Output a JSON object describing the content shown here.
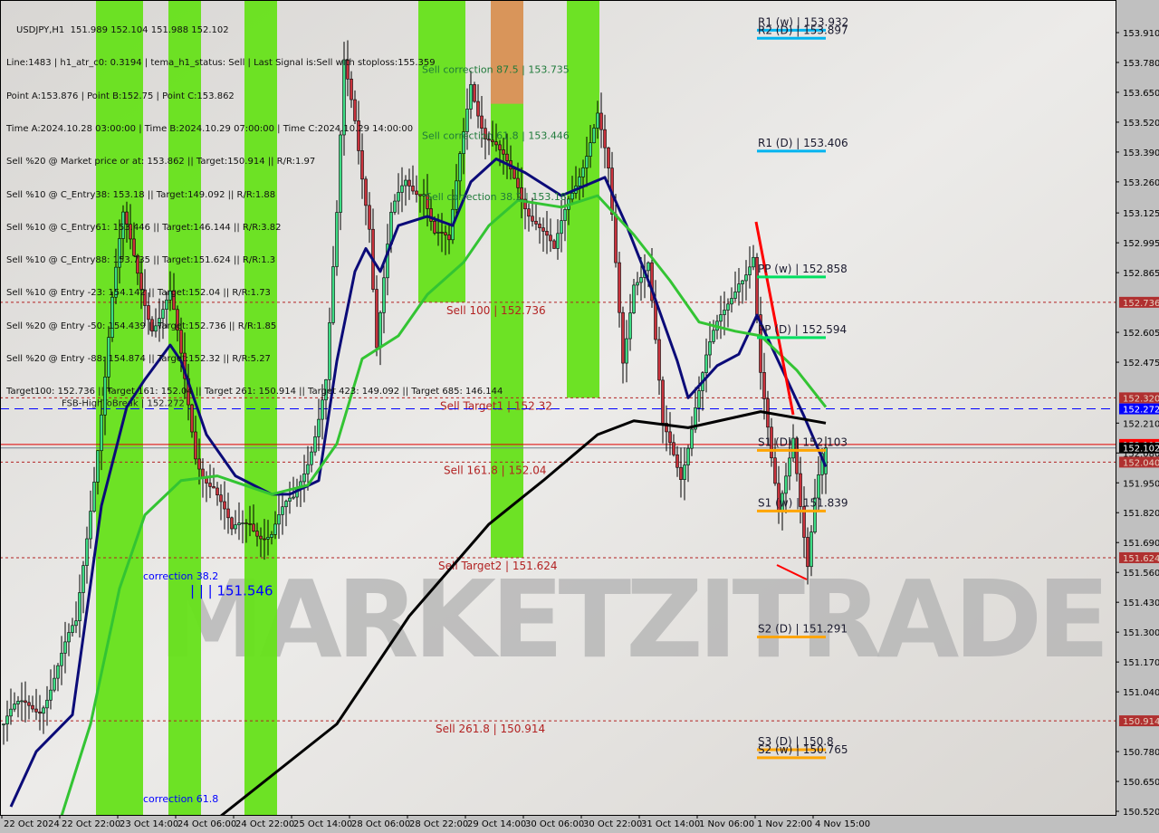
{
  "header": {
    "symbol": "USDJPY,H1",
    "ohlc": "151.989 152.104 151.988 152.102",
    "lines": [
      "Line:1483 | h1_atr_c0: 0.3194 | tema_h1_status: Sell | Last Signal is:Sell with stoploss:155.359",
      "Point A:153.876 | Point B:152.75 | Point C:153.862",
      "Time A:2024.10.28 03:00:00 | Time B:2024.10.29 07:00:00 | Time C:2024.10.29 14:00:00",
      "Sell %20 @ Market price or at: 153.862 || Target:150.914 || R/R:1.97",
      "Sell %10 @ C_Entry38: 153.18 || Target:149.092 || R/R:1.88",
      "Sell %10 @ C_Entry61: 153.446 || Target:146.144 || R/R:3.82",
      "Sell %10 @ C_Entry88: 153.735 || Target:151.624 || R/R:1.3",
      "Sell %10 @ Entry -23: 154.142 || Target:152.04 || R/R:1.73",
      "Sell %20 @ Entry -50: 154.439 || Target:152.736 || R/R:1.85",
      "Sell %20 @ Entry -88: 154.874 || Target:152.32 || R/R:5.27",
      "Target100: 152.736 || Target 161: 152.04 || Target 261: 150.914 || Target 423: 149.092 || Target 685: 146.144"
    ]
  },
  "watermark": "MARKETZITRADE",
  "colors": {
    "background": "#e2e0dd",
    "bull": "#3ddc84",
    "bear": "#c8323c",
    "zone": "#66e21a",
    "zone_orange": "#d9955a",
    "ma_fast": "#0b0b78",
    "ma_mid": "#33c433",
    "ma_slow": "#000000",
    "level_red": "#b22222",
    "level_blue": "#0000ff",
    "pivot_blue": "#00b4f0",
    "pivot_green": "#00e060",
    "pivot_orange": "#ffa500"
  },
  "chart_data": {
    "type": "candlestick",
    "instrument": "USDJPY",
    "timeframe": "H1",
    "ylim": [
      150.52,
      153.91
    ],
    "y_ticks": [
      "153.910",
      "153.780",
      "153.650",
      "153.520",
      "153.390",
      "153.260",
      "153.125",
      "152.995",
      "152.865",
      "152.605",
      "152.475",
      "152.210",
      "152.080",
      "151.950",
      "151.820",
      "151.690",
      "151.560",
      "151.430",
      "151.300",
      "151.170",
      "151.040",
      "150.780",
      "150.650",
      "150.520"
    ],
    "x_ticks": [
      {
        "bar": 0,
        "label": "22 Oct 2024"
      },
      {
        "bar": 16,
        "label": "22 Oct 22:00"
      },
      {
        "bar": 32,
        "label": "23 Oct 14:00"
      },
      {
        "bar": 48,
        "label": "24 Oct 06:00"
      },
      {
        "bar": 64,
        "label": "24 Oct 22:00"
      },
      {
        "bar": 80,
        "label": "25 Oct 14:00"
      },
      {
        "bar": 96,
        "label": "28 Oct 06:00"
      },
      {
        "bar": 112,
        "label": "28 Oct 22:00"
      },
      {
        "bar": 128,
        "label": "29 Oct 14:00"
      },
      {
        "bar": 144,
        "label": "30 Oct 06:00"
      },
      {
        "bar": 160,
        "label": "30 Oct 22:00"
      },
      {
        "bar": 176,
        "label": "31 Oct 14:00"
      },
      {
        "bar": 192,
        "label": "1 Nov 06:00"
      },
      {
        "bar": 208,
        "label": "1 Nov 22:00"
      },
      {
        "bar": 224,
        "label": "4 Nov 15:00"
      }
    ],
    "bars": 228,
    "close_path": [
      [
        0,
        150.9
      ],
      [
        10,
        151.0
      ],
      [
        20,
        151.3
      ],
      [
        26,
        152.15
      ],
      [
        30,
        152.75
      ],
      [
        33,
        153.07
      ],
      [
        37,
        152.86
      ],
      [
        41,
        152.67
      ],
      [
        46,
        152.75
      ],
      [
        50,
        152.36
      ],
      [
        53,
        152.08
      ],
      [
        58,
        151.96
      ],
      [
        63,
        151.69
      ],
      [
        68,
        151.8
      ],
      [
        74,
        151.73
      ],
      [
        80,
        151.85
      ],
      [
        84,
        152.08
      ],
      [
        89,
        152.4
      ],
      [
        92,
        153.07
      ],
      [
        94,
        153.74
      ],
      [
        97,
        153.54
      ],
      [
        101,
        153.11
      ],
      [
        103,
        152.56
      ],
      [
        107,
        153.07
      ],
      [
        111,
        153.26
      ],
      [
        116,
        153.26
      ],
      [
        119,
        153.03
      ],
      [
        123,
        152.95
      ],
      [
        126,
        153.38
      ],
      [
        129,
        153.74
      ],
      [
        133,
        153.46
      ],
      [
        137,
        153.34
      ],
      [
        142,
        153.26
      ],
      [
        147,
        153.11
      ],
      [
        152,
        152.91
      ],
      [
        156,
        153.19
      ],
      [
        159,
        153.34
      ],
      [
        164,
        153.54
      ],
      [
        167,
        153.26
      ],
      [
        171,
        152.48
      ],
      [
        174,
        152.87
      ],
      [
        178,
        152.91
      ],
      [
        182,
        152.15
      ],
      [
        187,
        152.0
      ],
      [
        191,
        152.32
      ],
      [
        194,
        152.48
      ],
      [
        199,
        152.67
      ],
      [
        203,
        152.87
      ],
      [
        207,
        152.95
      ],
      [
        209,
        152.4
      ],
      [
        212,
        152.0
      ],
      [
        214,
        151.8
      ],
      [
        218,
        152.2
      ],
      [
        222,
        151.6
      ],
      [
        224,
        151.85
      ],
      [
        227,
        152.102
      ]
    ],
    "last": {
      "open": 151.989,
      "high": 152.104,
      "low": 151.988,
      "close": 152.102
    },
    "moving_averages": [
      {
        "color_key": "ma_fast",
        "points": [
          [
            2,
            150.54
          ],
          [
            9,
            150.78
          ],
          [
            19,
            150.94
          ],
          [
            27,
            151.85
          ],
          [
            34,
            152.28
          ],
          [
            39,
            152.4
          ],
          [
            46,
            152.55
          ],
          [
            49,
            152.48
          ],
          [
            56,
            152.16
          ],
          [
            64,
            151.98
          ],
          [
            74,
            151.9
          ],
          [
            79,
            151.9
          ],
          [
            87,
            151.96
          ],
          [
            92,
            152.48
          ],
          [
            97,
            152.87
          ],
          [
            100,
            152.97
          ],
          [
            104,
            152.87
          ],
          [
            109,
            153.07
          ],
          [
            117,
            153.11
          ],
          [
            124,
            153.07
          ],
          [
            129,
            153.26
          ],
          [
            136,
            153.36
          ],
          [
            144,
            153.3
          ],
          [
            154,
            153.2
          ],
          [
            166,
            153.28
          ],
          [
            172,
            153.07
          ],
          [
            179,
            152.79
          ],
          [
            186,
            152.48
          ],
          [
            189,
            152.32
          ],
          [
            197,
            152.46
          ],
          [
            203,
            152.51
          ],
          [
            208,
            152.68
          ],
          [
            213,
            152.51
          ],
          [
            221,
            152.24
          ],
          [
            227,
            152.02
          ]
        ]
      },
      {
        "color_key": "ma_mid",
        "points": [
          [
            16,
            150.5
          ],
          [
            24,
            150.9
          ],
          [
            32,
            151.49
          ],
          [
            39,
            151.81
          ],
          [
            49,
            151.96
          ],
          [
            59,
            151.98
          ],
          [
            74,
            151.9
          ],
          [
            84,
            151.94
          ],
          [
            92,
            152.12
          ],
          [
            99,
            152.49
          ],
          [
            109,
            152.59
          ],
          [
            117,
            152.77
          ],
          [
            127,
            152.91
          ],
          [
            134,
            153.07
          ],
          [
            142,
            153.18
          ],
          [
            154,
            153.15
          ],
          [
            164,
            153.2
          ],
          [
            174,
            153.03
          ],
          [
            184,
            152.83
          ],
          [
            192,
            152.65
          ],
          [
            202,
            152.61
          ],
          [
            209,
            152.59
          ],
          [
            219,
            152.44
          ],
          [
            227,
            152.28
          ]
        ]
      },
      {
        "color_key": "ma_slow",
        "points": [
          [
            60,
            150.5
          ],
          [
            92,
            150.9
          ],
          [
            112,
            151.37
          ],
          [
            134,
            151.77
          ],
          [
            149,
            151.96
          ],
          [
            164,
            152.16
          ],
          [
            174,
            152.22
          ],
          [
            189,
            152.19
          ],
          [
            209,
            152.26
          ],
          [
            227,
            152.21
          ]
        ]
      }
    ],
    "zones": [
      {
        "from": 26,
        "to": 38,
        "color_key": "zone"
      },
      {
        "from": 46,
        "to": 54,
        "color_key": "zone"
      },
      {
        "from": 67,
        "to": 75,
        "color_key": "zone"
      },
      {
        "from": 115,
        "to": 127,
        "color_key": "zone",
        "low": 152.736
      },
      {
        "from": 135,
        "to": 143,
        "color_key": "zone",
        "low": 151.624,
        "orange_above": 153.6
      },
      {
        "from": 156,
        "to": 164,
        "color_key": "zone",
        "low": 152.32
      }
    ],
    "levels": [
      {
        "price": 152.736,
        "label": "Sell 100 | 152.736",
        "axis_label": "152.736",
        "style": "red"
      },
      {
        "price": 152.32,
        "label": "Sell Target1 | 152.32",
        "axis_label": "152.320",
        "style": "red"
      },
      {
        "price": 152.04,
        "label": "Sell 161.8 | 152.04",
        "axis_label": "152.040",
        "style": "red"
      },
      {
        "price": 151.624,
        "label": "Sell Target2 | 151.624",
        "axis_label": "151.624",
        "style": "red"
      },
      {
        "price": 150.914,
        "label": "Sell 261.8 | 150.914",
        "axis_label": "150.914",
        "style": "red"
      },
      {
        "price": 152.272,
        "label": "FSB-HighToBreak | 152.272",
        "axis_label": "152.272",
        "style": "blue"
      }
    ],
    "current_price": {
      "value": 152.102,
      "label": "152.102"
    },
    "ask_price": {
      "value": 152.117,
      "label": "152.117"
    },
    "pivots": [
      {
        "label": "R1 (w) | 153.932",
        "price": 153.932,
        "color_key": "pivot_blue"
      },
      {
        "label": "R2 (D) | 153.897",
        "price": 153.897,
        "color_key": "pivot_blue"
      },
      {
        "label": "R1 (D) | 153.406",
        "price": 153.406,
        "color_key": "pivot_blue"
      },
      {
        "label": "PP (w) | 152.858",
        "price": 152.858,
        "color_key": "pivot_green"
      },
      {
        "label": "PP (D) | 152.594",
        "price": 152.594,
        "color_key": "pivot_green"
      },
      {
        "label": "S1 (D) | 152.103",
        "price": 152.103,
        "color_key": "pivot_orange"
      },
      {
        "label": "S1 (w) | 151.839",
        "price": 151.839,
        "color_key": "pivot_orange"
      },
      {
        "label": "S2 (D) | 151.291",
        "price": 151.291,
        "color_key": "pivot_orange"
      },
      {
        "label": "S3 (D) | 150.8",
        "price": 150.8,
        "color_key": "pivot_orange"
      },
      {
        "label": "S2 (w) | 150.765",
        "price": 150.765,
        "color_key": "pivot_orange"
      }
    ],
    "annotations": [
      {
        "text": "Sell correction 87.5 | 153.735",
        "bar": 116,
        "price": 153.735,
        "color": "#1f7a3a"
      },
      {
        "text": "Sell correction 61.8 | 153.446",
        "bar": 116,
        "price": 153.446,
        "color": "#1f7a3a"
      },
      {
        "text": "Sell correction 38.2 | 153.18",
        "bar": 117,
        "price": 153.18,
        "color": "#1f7a3a"
      },
      {
        "text": "correction 38.2",
        "bar": 39,
        "price": 151.53,
        "color": "#0000ff"
      },
      {
        "text": "correction 61.8",
        "bar": 39,
        "price": 150.56,
        "color": "#0000ff"
      },
      {
        "text": "| | | 151.546",
        "bar": 52,
        "price": 151.46,
        "color": "#0000ff"
      }
    ]
  }
}
